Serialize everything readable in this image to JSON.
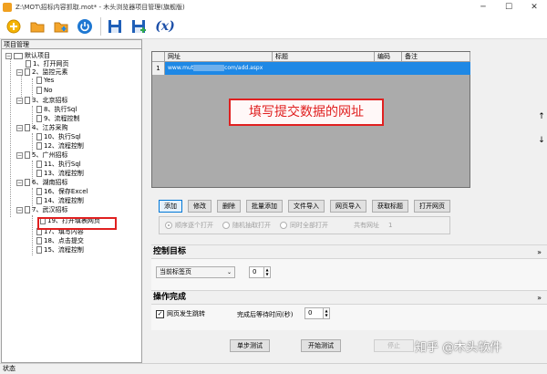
{
  "window": {
    "title": "Z:\\MOT\\招标内容抓取.mot* - 木头浏览器项目管理(旗舰版)",
    "minimize": "─",
    "maximize": "☐",
    "close": "✕"
  },
  "toolbar": {
    "buttons": [
      {
        "name": "new",
        "icon": "new-project-icon"
      },
      {
        "name": "open",
        "icon": "open-folder-icon"
      },
      {
        "name": "add",
        "icon": "add-folder-icon"
      },
      {
        "name": "power",
        "icon": "power-icon"
      },
      {
        "name": "save",
        "icon": "save-icon"
      },
      {
        "name": "saveas",
        "icon": "save-as-icon"
      },
      {
        "name": "variables",
        "icon": "variable-icon",
        "label": "(x)"
      }
    ]
  },
  "left_panel": {
    "header": "项目管理",
    "tree": [
      {
        "label": "默认项目"
      },
      {
        "label": "1、打开网页"
      },
      {
        "label": "2、监控元素"
      },
      {
        "label": "Yes"
      },
      {
        "label": "No"
      },
      {
        "label": "3、北京招标"
      },
      {
        "label": "8、执行Sql"
      },
      {
        "label": "9、流程控制"
      },
      {
        "label": "4、江苏采购"
      },
      {
        "label": "10、执行Sql"
      },
      {
        "label": "12、流程控制"
      },
      {
        "label": "5、广州招标"
      },
      {
        "label": "11、执行Sql"
      },
      {
        "label": "13、流程控制"
      },
      {
        "label": "6、湖南招标"
      },
      {
        "label": "16、保存Excel"
      },
      {
        "label": "14、流程控制"
      },
      {
        "label": "7、武汉招标"
      },
      {
        "label": "19、打开填表网页"
      },
      {
        "label": "17、填写内容"
      },
      {
        "label": "18、点击提交"
      },
      {
        "label": "15、流程控制"
      }
    ]
  },
  "grid": {
    "columns": [
      "网址",
      "标题",
      "编码",
      "备注"
    ],
    "rows": [
      {
        "num": "1",
        "url_prefix": "www.mut",
        "url_suffix": "com/add.aspx",
        "title": "",
        "code": "",
        "note": ""
      }
    ]
  },
  "callout": "填写提交数据的网址",
  "side_arrows": {
    "up": "↑",
    "down": "↓"
  },
  "action_buttons": [
    "添加",
    "修改",
    "删除",
    "批量添加",
    "文件导入",
    "网页导入",
    "获取标题",
    "打开网页"
  ],
  "open_options": {
    "sequential": "顺序逐个打开",
    "random": "随机抽取打开",
    "all": "同时全部打开",
    "count_label": "共有网址",
    "count": "1"
  },
  "control_target": {
    "header": "控制目标",
    "collapse": "»",
    "select_value": "当前标签页",
    "spin_value": "0"
  },
  "completion": {
    "header": "操作完成",
    "collapse": "»",
    "checkbox_label": "网页发生跳转",
    "checkbox_checked": "✓",
    "wait_label": "完成后等待时间(秒)",
    "wait_value": "0"
  },
  "bottom_buttons": {
    "step": "单步测试",
    "start": "开始测试",
    "stop": "停止"
  },
  "statusbar": "状态",
  "watermark": "知乎 @木头软件",
  "colors": {
    "selection": "#1e88e5",
    "highlight": "#e02020"
  }
}
